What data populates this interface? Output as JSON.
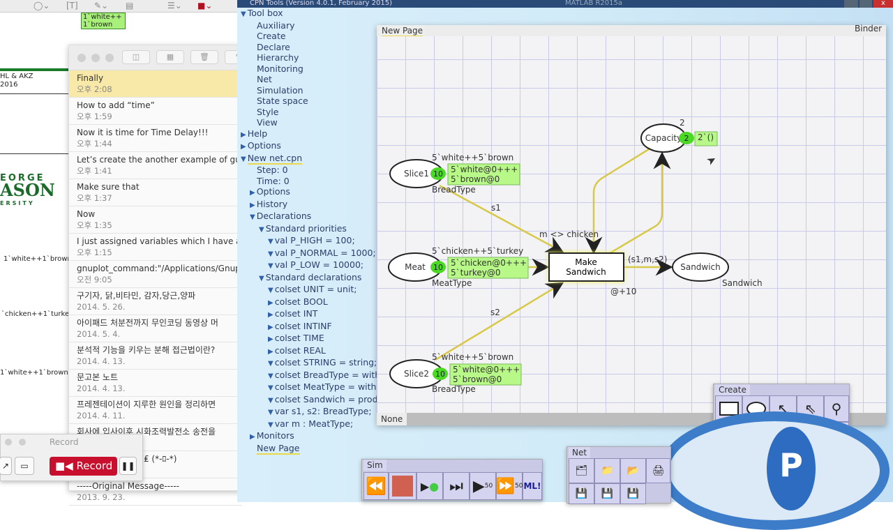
{
  "left_doc": {
    "green_note_top": [
      "1`white++",
      "1`brown"
    ],
    "header_text_1": "HL & AKZ",
    "header_text_2": "2016",
    "logo_lines": [
      "EORGE",
      "ASON",
      "ERSITY"
    ],
    "labels": [
      "1`white++1`brown",
      "`chicken++1`turkey",
      "1`white++1`brown"
    ]
  },
  "notes": {
    "items": [
      {
        "title": "Finally",
        "date": "오후 2:08",
        "selected": true
      },
      {
        "title": "How to add “time”",
        "date": "오후 1:59"
      },
      {
        "title": "Now it is time for Time Delay!!!",
        "date": "오후 1:44"
      },
      {
        "title": "Let’s create the another example of guard",
        "date": "오후 1:41"
      },
      {
        "title": "Make sure that",
        "date": "오후 1:37"
      },
      {
        "title": "Now",
        "date": "오후 1:35"
      },
      {
        "title": "I just assigned variables which I have already",
        "date": "오후 1:15"
      },
      {
        "title": "gnuplot_command:\"/Applications/Gnuplot",
        "date": "오전 9:05"
      },
      {
        "title": "구기자, 닭,비타민, 감자,당근,양파",
        "date": "2014. 5. 26."
      },
      {
        "title": "아이패드 처분전까지 무인코딩 동영상 머",
        "date": "2014. 5. 4."
      },
      {
        "title": "분석적 기능을 키우는 분해 접근법이란?",
        "date": "2014. 4. 13."
      },
      {
        "title": "문고본 노트",
        "date": "2014. 4. 13."
      },
      {
        "title": "프레젠테이션이 지루한 원인을 정리하면",
        "date": "2014. 4. 11."
      },
      {
        "title": "회사에 입사이후 시화조력발전소 송전을",
        "date": ""
      },
      {
        "title": "다기보단 단체톡이 ₤ (*-ﾛ-*)",
        "date": ""
      },
      {
        "title": "-----Original Message-----",
        "date": "2013. 9. 23."
      }
    ]
  },
  "record": {
    "title": "Record",
    "button": "Record",
    "accent": "#c8102e"
  },
  "cpn": {
    "title": "CPN Tools (Version 4.0.1, February 2015)",
    "taskbar_item": "MATLAB R2015a",
    "tree": [
      {
        "label": "Tool box",
        "level": 0,
        "arrow": "down"
      },
      {
        "label": "Auxiliary",
        "level": 1
      },
      {
        "label": "Create",
        "level": 1
      },
      {
        "label": "Declare",
        "level": 1
      },
      {
        "label": "Hierarchy",
        "level": 1
      },
      {
        "label": "Monitoring",
        "level": 1
      },
      {
        "label": "Net",
        "level": 1
      },
      {
        "label": "Simulation",
        "level": 1
      },
      {
        "label": "State space",
        "level": 1
      },
      {
        "label": "Style",
        "level": 1
      },
      {
        "label": "View",
        "level": 1
      },
      {
        "label": "Help",
        "level": 0,
        "arrow": "right"
      },
      {
        "label": "Options",
        "level": 0,
        "arrow": "right"
      },
      {
        "label": "New net.cpn",
        "level": 0,
        "arrow": "down",
        "underline": true
      },
      {
        "label": "Step: 0",
        "level": 1
      },
      {
        "label": "Time: 0",
        "level": 1
      },
      {
        "label": "Options",
        "level": 1,
        "arrow": "right"
      },
      {
        "label": "History",
        "level": 1,
        "arrow": "right"
      },
      {
        "label": "Declarations",
        "level": 1,
        "arrow": "down"
      },
      {
        "label": "Standard priorities",
        "level": 2,
        "arrow": "down"
      },
      {
        "label": "val P_HIGH = 100;",
        "level": 3,
        "arrow": "down"
      },
      {
        "label": "val P_NORMAL = 1000;",
        "level": 3,
        "arrow": "down"
      },
      {
        "label": "val P_LOW = 10000;",
        "level": 3,
        "arrow": "down"
      },
      {
        "label": "Standard declarations",
        "level": 2,
        "arrow": "down"
      },
      {
        "label": "colset UNIT = unit;",
        "level": 3,
        "arrow": "down"
      },
      {
        "label": "colset BOOL",
        "level": 3,
        "arrow": "right"
      },
      {
        "label": "colset INT",
        "level": 3,
        "arrow": "right"
      },
      {
        "label": "colset INTINF",
        "level": 3,
        "arrow": "right"
      },
      {
        "label": "colset TIME",
        "level": 3,
        "arrow": "right"
      },
      {
        "label": "colset REAL",
        "level": 3,
        "arrow": "right"
      },
      {
        "label": "colset STRING = string;",
        "level": 3,
        "arrow": "down"
      },
      {
        "label": "colset BreadType = with",
        "level": 3,
        "arrow": "down"
      },
      {
        "label": "colset MeatType = with",
        "level": 3,
        "arrow": "down"
      },
      {
        "label": "colset Sandwich = produ",
        "level": 3,
        "arrow": "down"
      },
      {
        "label": "var s1, s2: BreadType;",
        "level": 3,
        "arrow": "down"
      },
      {
        "label": "var m : MeatType;",
        "level": 3,
        "arrow": "down"
      },
      {
        "label": "Monitors",
        "level": 1,
        "arrow": "right"
      },
      {
        "label": "New Page",
        "level": 1,
        "underline": true
      }
    ],
    "page_tab": "New Page",
    "binder_label": "Binder",
    "status_tab": "None",
    "net": {
      "places": [
        {
          "name": "Slice1",
          "init": "5`white++5`brown",
          "type": "BreadType",
          "tokens": "10",
          "marking": [
            "5`white@0+++",
            "5`brown@0"
          ]
        },
        {
          "name": "Meat",
          "init": "5`chicken++5`turkey",
          "type": "MeatType",
          "tokens": "10",
          "marking": [
            "5`chicken@0+++",
            "5`turkey@0"
          ]
        },
        {
          "name": "Slice2",
          "init": "5`white++5`brown",
          "type": "BreadType",
          "tokens": "10",
          "marking": [
            "5`white@0+++",
            "5`brown@0"
          ]
        },
        {
          "name": "Capacity",
          "init": "2",
          "tokens": "2",
          "marking": [
            "2`()"
          ]
        },
        {
          "name": "Sandwich",
          "type": "Sandwich"
        }
      ],
      "transition": {
        "name": [
          "Make",
          "Sandwich"
        ],
        "guard": "m <> chicken",
        "time": "@+10"
      },
      "arcs": {
        "s1": "s1",
        "s2": "s2",
        "out": "(s1,m,s2)"
      },
      "colors": {
        "arc": "#d8c848",
        "token": "#4cd824",
        "marking": "#b8f888"
      }
    },
    "palettes": {
      "create": {
        "title": "Create",
        "tools": [
          "rectangle-transition",
          "ellipse-place",
          "arc",
          "double-arc",
          "inhibitor",
          "delete",
          "clone",
          "reverse-arc",
          "toggle-arc",
          "port"
        ]
      },
      "net": {
        "title": "Net",
        "tools": [
          "new-page",
          "new-net",
          "open-net",
          "print",
          "save-net",
          "save-as",
          "save-copy"
        ]
      },
      "sim": {
        "title": "Sim",
        "tools": [
          "rewind",
          "stop",
          "play-one",
          "step",
          "play-n",
          "fast-forward",
          "ml"
        ],
        "play_n": "50",
        "ff_n": "50",
        "ml_label": "ML!"
      }
    }
  }
}
